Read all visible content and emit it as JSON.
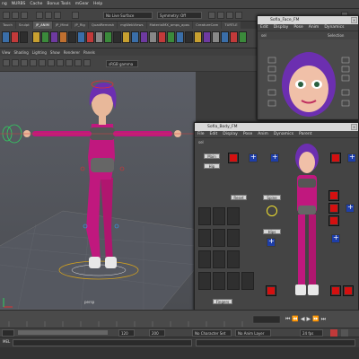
{
  "menubar": {
    "items": [
      "ng",
      "NURBS",
      "Cache",
      "Bonus Tools",
      "mGear",
      "Help"
    ]
  },
  "toolbar": {
    "no_live_surface": "No Live Surface",
    "symmetry": "Symmetry: Off",
    "user_label": "Sign In"
  },
  "shelf_tabs": [
    "Touch",
    "Sculpt",
    "JP_ANIM",
    "JP_Mind",
    "JP_Rig",
    "QuadRemesh",
    "mgWebViews",
    "MaterialMX_amps_apas",
    "CreatureCam",
    "TURTLE"
  ],
  "viewport": {
    "renderer_label": "sRGB gamma",
    "camera_label": "persp"
  },
  "face_window": {
    "title": "Sofia_Face_FM",
    "menus": [
      "Edit",
      "Display",
      "Pose",
      "Anim",
      "Dynamics",
      "Parent"
    ],
    "tab_label": "sel",
    "selection_label": "Selection"
  },
  "body_window": {
    "title": "Sofia_Body_FM",
    "menus": [
      "File",
      "Edit",
      "Display",
      "Pose",
      "Anim",
      "Dynamics",
      "Parent"
    ],
    "tab_label": "sel",
    "buttons": [
      "Main",
      "Hip",
      "Spine",
      "Neck",
      "Spine",
      "Hips",
      "Fingers"
    ],
    "reset_label": "Reset"
  },
  "timeline": {
    "start_frame": "120",
    "end_frame": "200",
    "character_set": "No Character Set",
    "anim_layer": "No Anim Layer",
    "fps": "24 fps"
  },
  "colors": {
    "red_control": "#d41010",
    "blue_control": "#1e3ea8",
    "body_pink": "#c0187e",
    "hair_purple": "#6c2fb0"
  }
}
